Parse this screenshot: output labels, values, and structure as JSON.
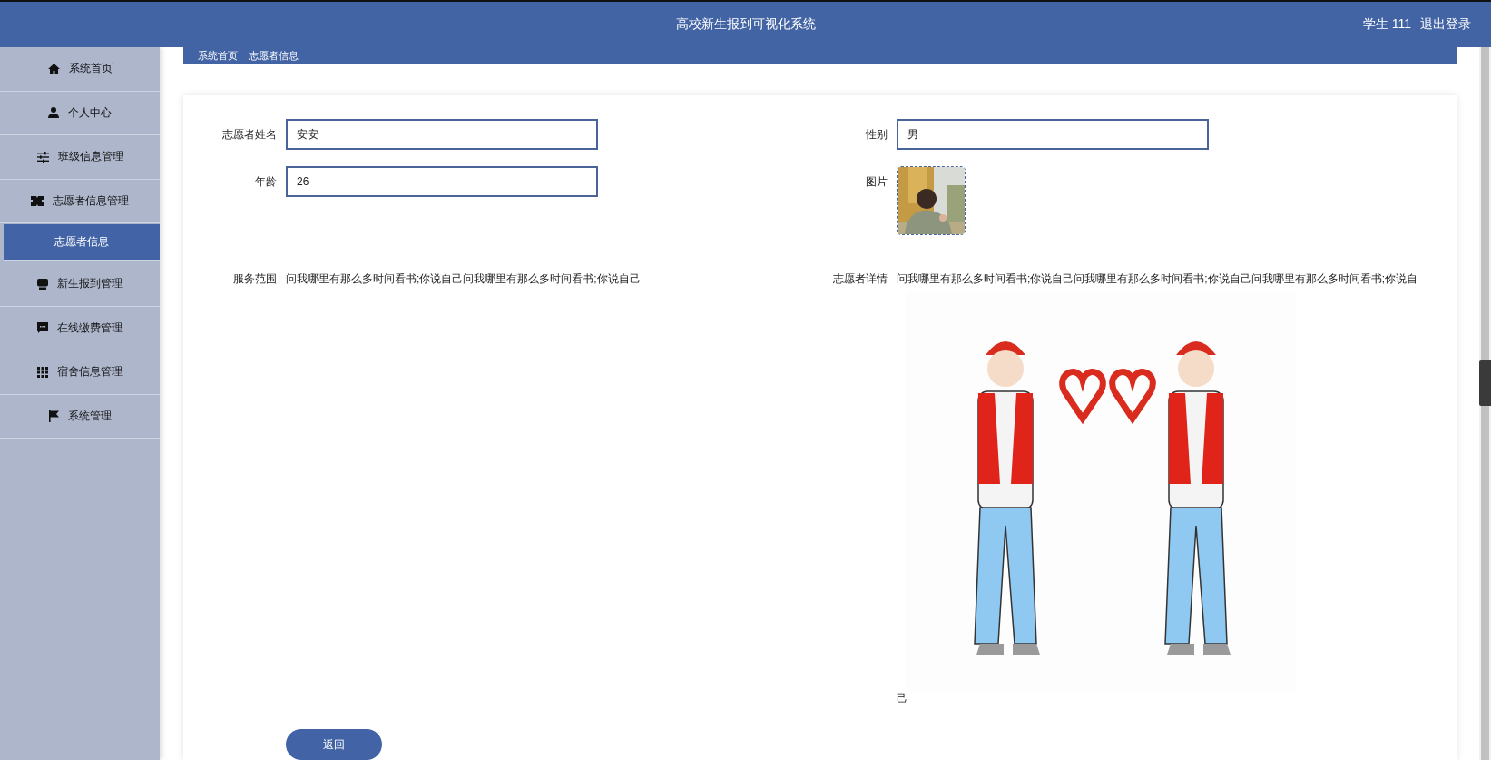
{
  "header": {
    "title": "高校新生报到可视化系统",
    "user": "学生 111",
    "logout": "退出登录"
  },
  "breadcrumb": [
    "系统首页",
    "志愿者信息"
  ],
  "sidebar": {
    "items": [
      {
        "label": "系统首页",
        "kind": "home",
        "selected": false
      },
      {
        "label": "个人中心",
        "kind": "user",
        "selected": false
      },
      {
        "label": "班级信息管理",
        "kind": "sliders",
        "selected": false
      },
      {
        "label": "志愿者信息管理",
        "kind": "ticket",
        "selected": false,
        "children": [
          {
            "label": "志愿者信息",
            "selected": true
          }
        ]
      },
      {
        "label": "新生报到管理",
        "kind": "monitor",
        "selected": false
      },
      {
        "label": "在线缴费管理",
        "kind": "chat",
        "selected": false
      },
      {
        "label": "宿舍信息管理",
        "kind": "grid",
        "selected": false
      },
      {
        "label": "系统管理",
        "kind": "flag",
        "selected": false
      }
    ]
  },
  "form": {
    "fields": [
      {
        "kind": "input",
        "label": "志愿者姓名",
        "value": "安安"
      },
      {
        "kind": "input",
        "label": "性别",
        "value": "男"
      },
      {
        "kind": "input",
        "label": "年龄",
        "value": "26"
      },
      {
        "label": "图片"
      },
      {
        "kind": "text",
        "label": "服务范围",
        "text": "问我哪里有那么多时间看书;你说自己问我哪里有那么多时间看书;你说自己"
      },
      {
        "kind": "rich",
        "label": "志愿者详情",
        "parts": [
          {
            "kind": "text",
            "text": "问我哪里有那么多时间看书;你说自己问我哪里有那么多时间看书;你说自己问我哪里有那么多时间看书;你说自"
          },
          {
            "kind": "picture"
          },
          {
            "kind": "text",
            "text": "己"
          }
        ]
      }
    ]
  },
  "buttons": [
    {
      "label": "返回"
    }
  ]
}
